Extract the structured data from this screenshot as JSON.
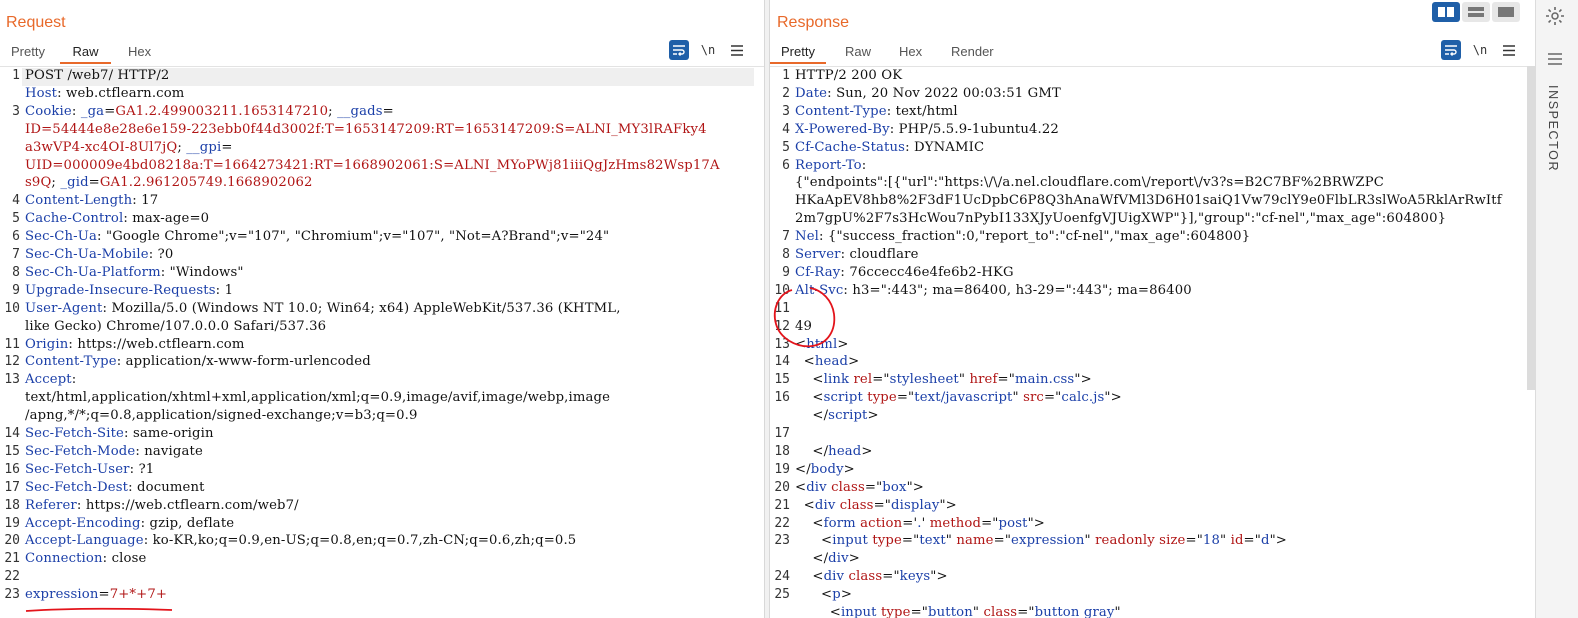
{
  "request": {
    "title": "Request",
    "tabs": [
      "Pretty",
      "Raw",
      "Hex"
    ],
    "active_tab": "Raw",
    "lines": [
      {
        "n": "1",
        "parts": [
          [
            "POST /web7/ HTTP/2",
            ""
          ]
        ]
      },
      {
        "n": "",
        "parts": [
          [
            "Host",
            "hn"
          ],
          [
            ": web.ctflearn.com",
            ""
          ]
        ]
      },
      {
        "n": "3",
        "parts": [
          [
            "Cookie",
            "hn"
          ],
          [
            ": ",
            ""
          ],
          [
            "_ga",
            "hn"
          ],
          [
            "=",
            ""
          ],
          [
            "GA1.2.499003211.1653147210",
            "rv"
          ],
          [
            "; ",
            ""
          ],
          [
            "__gads",
            "hn"
          ],
          [
            "=",
            ""
          ]
        ]
      },
      {
        "n": "",
        "parts": [
          [
            "ID=54444e8e28e6e159-223ebb0f44d3002f:T=1653147209:RT=1653147209:S=ALNI_MY3lRAFky4",
            "rv"
          ]
        ]
      },
      {
        "n": "",
        "parts": [
          [
            "a3wVP4-xc4OI-8Ul7jQ",
            "rv"
          ],
          [
            "; ",
            ""
          ],
          [
            "__gpi",
            "hn"
          ],
          [
            "=",
            ""
          ]
        ]
      },
      {
        "n": "",
        "parts": [
          [
            "UID=000009e4bd08218a:T=1664273421:RT=1668902061:S=ALNI_MYoPWj81iiiQgJzHms82Wsp17A",
            "rv"
          ]
        ]
      },
      {
        "n": "",
        "parts": [
          [
            "s9Q",
            "rv"
          ],
          [
            "; ",
            ""
          ],
          [
            "_gid",
            "hn"
          ],
          [
            "=",
            ""
          ],
          [
            "GA1.2.961205749.1668902062",
            "rv"
          ]
        ]
      },
      {
        "n": "4",
        "parts": [
          [
            "Content-Length",
            "hn"
          ],
          [
            ": 17",
            ""
          ]
        ]
      },
      {
        "n": "5",
        "parts": [
          [
            "Cache-Control",
            "hn"
          ],
          [
            ": max-age=0",
            ""
          ]
        ]
      },
      {
        "n": "6",
        "parts": [
          [
            "Sec-Ch-Ua",
            "hn"
          ],
          [
            ": \"Google Chrome\";v=\"107\", \"Chromium\";v=\"107\", \"Not=A?Brand\";v=\"24\"",
            ""
          ]
        ]
      },
      {
        "n": "7",
        "parts": [
          [
            "Sec-Ch-Ua-Mobile",
            "hn"
          ],
          [
            ": ?0",
            ""
          ]
        ]
      },
      {
        "n": "8",
        "parts": [
          [
            "Sec-Ch-Ua-Platform",
            "hn"
          ],
          [
            ": \"Windows\"",
            ""
          ]
        ]
      },
      {
        "n": "9",
        "parts": [
          [
            "Upgrade-Insecure-Requests",
            "hn"
          ],
          [
            ": 1",
            ""
          ]
        ]
      },
      {
        "n": "10",
        "parts": [
          [
            "User-Agent",
            "hn"
          ],
          [
            ": Mozilla/5.0 (Windows NT 10.0; Win64; x64) AppleWebKit/537.36 (KHTML,",
            ""
          ]
        ]
      },
      {
        "n": "",
        "parts": [
          [
            "like Gecko) Chrome/107.0.0.0 Safari/537.36",
            ""
          ]
        ]
      },
      {
        "n": "11",
        "parts": [
          [
            "Origin",
            "hn"
          ],
          [
            ": https://web.ctflearn.com",
            ""
          ]
        ]
      },
      {
        "n": "12",
        "parts": [
          [
            "Content-Type",
            "hn"
          ],
          [
            ": application/x-www-form-urlencoded",
            ""
          ]
        ]
      },
      {
        "n": "13",
        "parts": [
          [
            "Accept",
            "hn"
          ],
          [
            ":",
            ""
          ]
        ]
      },
      {
        "n": "",
        "parts": [
          [
            "text/html,application/xhtml+xml,application/xml;q=0.9,image/avif,image/webp,image",
            ""
          ]
        ]
      },
      {
        "n": "",
        "parts": [
          [
            "/apng,*/*;q=0.8,application/signed-exchange;v=b3;q=0.9",
            ""
          ]
        ]
      },
      {
        "n": "14",
        "parts": [
          [
            "Sec-Fetch-Site",
            "hn"
          ],
          [
            ": same-origin",
            ""
          ]
        ]
      },
      {
        "n": "15",
        "parts": [
          [
            "Sec-Fetch-Mode",
            "hn"
          ],
          [
            ": navigate",
            ""
          ]
        ]
      },
      {
        "n": "16",
        "parts": [
          [
            "Sec-Fetch-User",
            "hn"
          ],
          [
            ": ?1",
            ""
          ]
        ]
      },
      {
        "n": "17",
        "parts": [
          [
            "Sec-Fetch-Dest",
            "hn"
          ],
          [
            ": document",
            ""
          ]
        ]
      },
      {
        "n": "18",
        "parts": [
          [
            "Referer",
            "hn"
          ],
          [
            ": https://web.ctflearn.com/web7/",
            ""
          ]
        ]
      },
      {
        "n": "19",
        "parts": [
          [
            "Accept-Encoding",
            "hn"
          ],
          [
            ": gzip, deflate",
            ""
          ]
        ]
      },
      {
        "n": "20",
        "parts": [
          [
            "Accept-Language",
            "hn"
          ],
          [
            ": ko-KR,ko;q=0.9,en-US;q=0.8,en;q=0.7,zh-CN;q=0.6,zh;q=0.5",
            ""
          ]
        ]
      },
      {
        "n": "21",
        "parts": [
          [
            "Connection",
            "hn"
          ],
          [
            ": close",
            ""
          ]
        ]
      },
      {
        "n": "22",
        "parts": []
      },
      {
        "n": "23",
        "parts": [
          [
            "expression",
            "hn"
          ],
          [
            "=",
            ""
          ],
          [
            "7+*+7+",
            "rv"
          ]
        ]
      }
    ]
  },
  "response": {
    "title": "Response",
    "tabs": [
      "Pretty",
      "Raw",
      "Hex",
      "Render"
    ],
    "active_tab": "Pretty",
    "lines": [
      {
        "n": "1",
        "parts": [
          [
            "HTTP/2 200 OK",
            ""
          ]
        ]
      },
      {
        "n": "2",
        "parts": [
          [
            "Date",
            "hn"
          ],
          [
            ": Sun, 20 Nov 2022 00:03:51 GMT",
            ""
          ]
        ]
      },
      {
        "n": "3",
        "parts": [
          [
            "Content-Type",
            "hn"
          ],
          [
            ": text/html",
            ""
          ]
        ]
      },
      {
        "n": "4",
        "parts": [
          [
            "X-Powered-By",
            "hn"
          ],
          [
            ": PHP/5.5.9-1ubuntu4.22",
            ""
          ]
        ]
      },
      {
        "n": "5",
        "parts": [
          [
            "Cf-Cache-Status",
            "hn"
          ],
          [
            ": DYNAMIC",
            ""
          ]
        ]
      },
      {
        "n": "6",
        "parts": [
          [
            "Report-To",
            "hn"
          ],
          [
            ":",
            ""
          ]
        ]
      },
      {
        "n": "",
        "parts": [
          [
            "{\"endpoints\":[{\"url\":\"https:\\/\\/a.nel.cloudflare.com\\/report\\/v3?s=B2C7BF%2BRWZPC",
            ""
          ]
        ]
      },
      {
        "n": "",
        "parts": [
          [
            "HKaApEV8hb8%2F3dF1UcDpbC6P8Q3hAnaWfVMl3D6H01saiQ1Vw79clY9e0FlbLR3slWoA5RklArRwItf",
            ""
          ]
        ]
      },
      {
        "n": "",
        "parts": [
          [
            "2m7gpU%2F7s3HcWou7nPybI133XJyUoenfgVJUigXWP\"}],\"group\":\"cf-nel\",\"max_age\":604800}",
            ""
          ]
        ]
      },
      {
        "n": "7",
        "parts": [
          [
            "Nel",
            "hn"
          ],
          [
            ": {\"success_fraction\":0,\"report_to\":\"cf-nel\",\"max_age\":604800}",
            ""
          ]
        ]
      },
      {
        "n": "8",
        "parts": [
          [
            "Server",
            "hn"
          ],
          [
            ": cloudflare",
            ""
          ]
        ]
      },
      {
        "n": "9",
        "parts": [
          [
            "Cf-Ray",
            "hn"
          ],
          [
            ": 76ccecc46e4fe6b2-HKG",
            ""
          ]
        ]
      },
      {
        "n": "10",
        "parts": [
          [
            "Alt-Svc",
            "hn"
          ],
          [
            ": h3=\":443\"; ma=86400, h3-29=\":443\"; ma=86400",
            ""
          ]
        ]
      },
      {
        "n": "11",
        "parts": []
      },
      {
        "n": "12",
        "parts": [
          [
            "49",
            ""
          ]
        ]
      },
      {
        "n": "13",
        "parts": [
          [
            "<",
            ""
          ],
          [
            "html",
            "tg"
          ],
          [
            ">",
            ""
          ]
        ]
      },
      {
        "n": "14",
        "parts": [
          [
            "  <",
            ""
          ],
          [
            "head",
            "tg"
          ],
          [
            ">",
            ""
          ]
        ]
      },
      {
        "n": "15",
        "parts": [
          [
            "    <",
            ""
          ],
          [
            "link",
            "tg"
          ],
          [
            " ",
            ""
          ],
          [
            "rel",
            "at"
          ],
          [
            "=\"",
            ""
          ],
          [
            "stylesheet",
            "av"
          ],
          [
            "\" ",
            ""
          ],
          [
            "href",
            "at"
          ],
          [
            "=\"",
            ""
          ],
          [
            "main.css",
            "av"
          ],
          [
            "\">",
            ""
          ]
        ]
      },
      {
        "n": "16",
        "parts": [
          [
            "    <",
            ""
          ],
          [
            "script",
            "tg"
          ],
          [
            " ",
            ""
          ],
          [
            "type",
            "at"
          ],
          [
            "=\"",
            ""
          ],
          [
            "text/javascript",
            "av"
          ],
          [
            "\" ",
            ""
          ],
          [
            "src",
            "at"
          ],
          [
            "=\"",
            ""
          ],
          [
            "calc.js",
            "av"
          ],
          [
            "\">",
            ""
          ]
        ]
      },
      {
        "n": "",
        "parts": [
          [
            "    </",
            ""
          ],
          [
            "script",
            "tg"
          ],
          [
            ">",
            ""
          ]
        ]
      },
      {
        "n": "17",
        "parts": []
      },
      {
        "n": "18",
        "parts": [
          [
            "    </",
            ""
          ],
          [
            "head",
            "tg"
          ],
          [
            ">",
            ""
          ]
        ]
      },
      {
        "n": "19",
        "parts": [
          [
            "</",
            ""
          ],
          [
            "body",
            "tg"
          ],
          [
            ">",
            ""
          ]
        ]
      },
      {
        "n": "20",
        "parts": [
          [
            "<",
            ""
          ],
          [
            "div",
            "tg"
          ],
          [
            " ",
            ""
          ],
          [
            "class",
            "at"
          ],
          [
            "=\"",
            ""
          ],
          [
            "box",
            "av"
          ],
          [
            "\">",
            ""
          ]
        ]
      },
      {
        "n": "21",
        "parts": [
          [
            "  <",
            ""
          ],
          [
            "div",
            "tg"
          ],
          [
            " ",
            ""
          ],
          [
            "class",
            "at"
          ],
          [
            "=\"",
            ""
          ],
          [
            "display",
            "av"
          ],
          [
            "\">",
            ""
          ]
        ]
      },
      {
        "n": "22",
        "parts": [
          [
            "    <",
            ""
          ],
          [
            "form",
            "tg"
          ],
          [
            " ",
            ""
          ],
          [
            "action",
            "at"
          ],
          [
            "='",
            ""
          ],
          [
            ".",
            "av"
          ],
          [
            "' ",
            ""
          ],
          [
            "method",
            "at"
          ],
          [
            "=\"",
            ""
          ],
          [
            "post",
            "av"
          ],
          [
            "\">",
            ""
          ]
        ]
      },
      {
        "n": "23",
        "parts": [
          [
            "      <",
            ""
          ],
          [
            "input",
            "tg"
          ],
          [
            " ",
            ""
          ],
          [
            "type",
            "at"
          ],
          [
            "=\"",
            ""
          ],
          [
            "text",
            "av"
          ],
          [
            "\" ",
            ""
          ],
          [
            "name",
            "at"
          ],
          [
            "=\"",
            ""
          ],
          [
            "expression",
            "av"
          ],
          [
            "\" ",
            ""
          ],
          [
            "readonly",
            "at"
          ],
          [
            " ",
            ""
          ],
          [
            "size",
            "at"
          ],
          [
            "=\"",
            ""
          ],
          [
            "18",
            "av"
          ],
          [
            "\" ",
            ""
          ],
          [
            "id",
            "at"
          ],
          [
            "=\"",
            ""
          ],
          [
            "d",
            "av"
          ],
          [
            "\">",
            ""
          ]
        ]
      },
      {
        "n": "",
        "parts": [
          [
            "    </",
            ""
          ],
          [
            "div",
            "tg"
          ],
          [
            ">",
            ""
          ]
        ]
      },
      {
        "n": "24",
        "parts": [
          [
            "    <",
            ""
          ],
          [
            "div",
            "tg"
          ],
          [
            " ",
            ""
          ],
          [
            "class",
            "at"
          ],
          [
            "=\"",
            ""
          ],
          [
            "keys",
            "av"
          ],
          [
            "\">",
            ""
          ]
        ]
      },
      {
        "n": "25",
        "parts": [
          [
            "      <",
            ""
          ],
          [
            "p",
            "tg"
          ],
          [
            ">",
            ""
          ]
        ]
      },
      {
        "n": "",
        "parts": [
          [
            "        <",
            ""
          ],
          [
            "input",
            "tg"
          ],
          [
            " ",
            ""
          ],
          [
            "type",
            "at"
          ],
          [
            "=\"",
            ""
          ],
          [
            "button",
            "av"
          ],
          [
            "\" ",
            ""
          ],
          [
            "class",
            "at"
          ],
          [
            "=\"",
            ""
          ],
          [
            "button gray",
            "av"
          ],
          [
            "\"",
            ""
          ]
        ]
      }
    ]
  },
  "toolbar": {
    "wrap_icon": "word-wrap-icon",
    "newline_label": "\\n",
    "menu_icon": "hamburger-menu-icon"
  },
  "inspector": {
    "label": "INSPECTOR",
    "settings_icon": "gear-icon",
    "menu_icon": "hamburger-menu-icon"
  },
  "layout": {
    "icons": [
      "split-horizontal-icon",
      "split-vertical-icon",
      "single-pane-icon"
    ]
  },
  "colors": {
    "accent": "#e8692a",
    "header_name": "#1b3fa8",
    "header_value_red": "#b01515",
    "active_button": "#1f5fa8"
  }
}
